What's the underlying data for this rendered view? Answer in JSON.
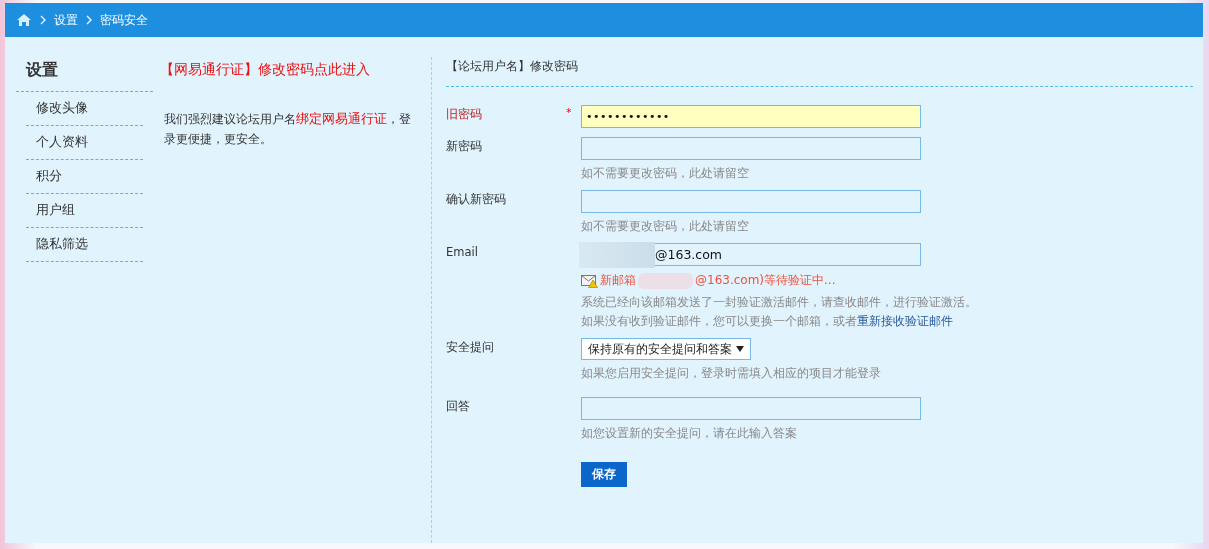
{
  "breadcrumb": {
    "items": [
      "设置",
      "密码安全"
    ]
  },
  "sidebar": {
    "title": "设置",
    "items": [
      {
        "label": "修改头像",
        "selected": false
      },
      {
        "label": "个人资料",
        "selected": false
      },
      {
        "label": "积分",
        "selected": false
      },
      {
        "label": "用户组",
        "selected": false
      },
      {
        "label": "隐私筛选",
        "selected": false
      }
    ]
  },
  "promo": {
    "link": "【网易通行证】修改密码点此进入",
    "text": "我们强烈建议论坛用户名**绑定网易通行证**，登录更便捷，更安全。"
  },
  "form": {
    "title": "【论坛用户名】修改密码",
    "fields": [
      {
        "kind": "password",
        "label": "旧密码",
        "required_mark": "*",
        "value": "••••••••••••",
        "highlighted": true
      },
      {
        "kind": "password",
        "label": "新密码",
        "hint": "如不需要更改密码，此处请留空"
      },
      {
        "kind": "password",
        "label": "确认新密码",
        "hint": "如不需要更改密码，此处请留空"
      },
      {
        "kind": "email",
        "label": "Email",
        "value": "@163.com",
        "notice_start": "新邮箱",
        "notice_end": "@163.com)等待验证中...",
        "notice_line": "系统已经向该邮箱发送了一封验证激活邮件，请查收邮件，进行验证激活。",
        "notice_line2": "如果没有收到验证邮件，您可以更换一个邮箱，或者",
        "resend_link": "重新接收验证邮件"
      },
      {
        "kind": "select",
        "label": "安全提问",
        "value": "保持原有的安全提问和答案",
        "hint": "如果您启用安全提问，登录时需填入相应的项目才能登录"
      },
      {
        "kind": "text",
        "label": "回答",
        "hint": "如您设置新的安全提问，请在此输入答案"
      }
    ],
    "submit": "保存"
  }
}
